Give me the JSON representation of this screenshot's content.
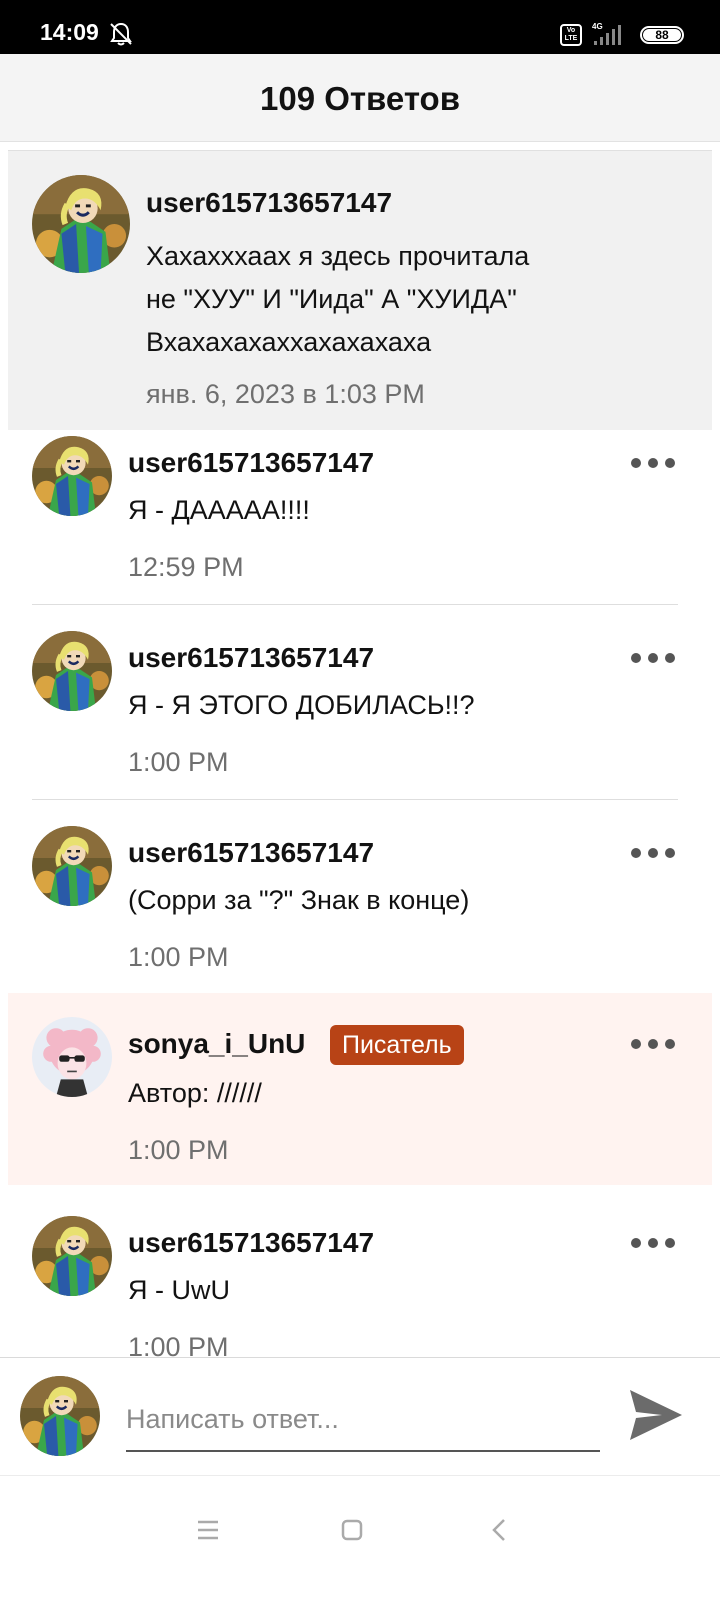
{
  "status_bar": {
    "time": "14:09",
    "battery": "88",
    "network": "4G",
    "volte": "Vo LTE",
    "icons": [
      "bell-off-icon",
      "volte-icon",
      "signal-icon",
      "battery-icon"
    ]
  },
  "header": {
    "title": "109 Ответов"
  },
  "original_comment": {
    "username": "user615713657147",
    "lines": [
      "Хахахххаах я здесь прочитала",
      "не \"ХУУ\" И \"Иида\" А \"ХУИДА\"",
      "Вхахахахаххахахахаха"
    ],
    "timestamp": "янв. 6, 2023 в 1:03 PM"
  },
  "replies": [
    {
      "username": "user615713657147",
      "message": "Я - ДААААА!!!!",
      "time": "12:59 PM"
    },
    {
      "username": "user615713657147",
      "message": "Я - Я ЭТОГО ДОБИЛАСЬ!!?",
      "time": "1:00 PM"
    },
    {
      "username": "user615713657147",
      "message": "(Сорри за \"?\" Знак в конце)",
      "time": "1:00 PM"
    },
    {
      "username": "sonya_i_UnU",
      "badge": "Писатель",
      "message": "Автор: //////",
      "time": "1:00 PM"
    },
    {
      "username": "user615713657147",
      "message": "Я - UwU",
      "time": "1:00 PM"
    }
  ],
  "composer": {
    "placeholder": "Написать ответ..."
  },
  "colors": {
    "header_bg": "#f4f4f4",
    "original_bg": "#f1f1f1",
    "author_highlight": "#fff3f0",
    "writer_badge": "#b84316",
    "timestamp_gray": "#6f6f6f"
  }
}
